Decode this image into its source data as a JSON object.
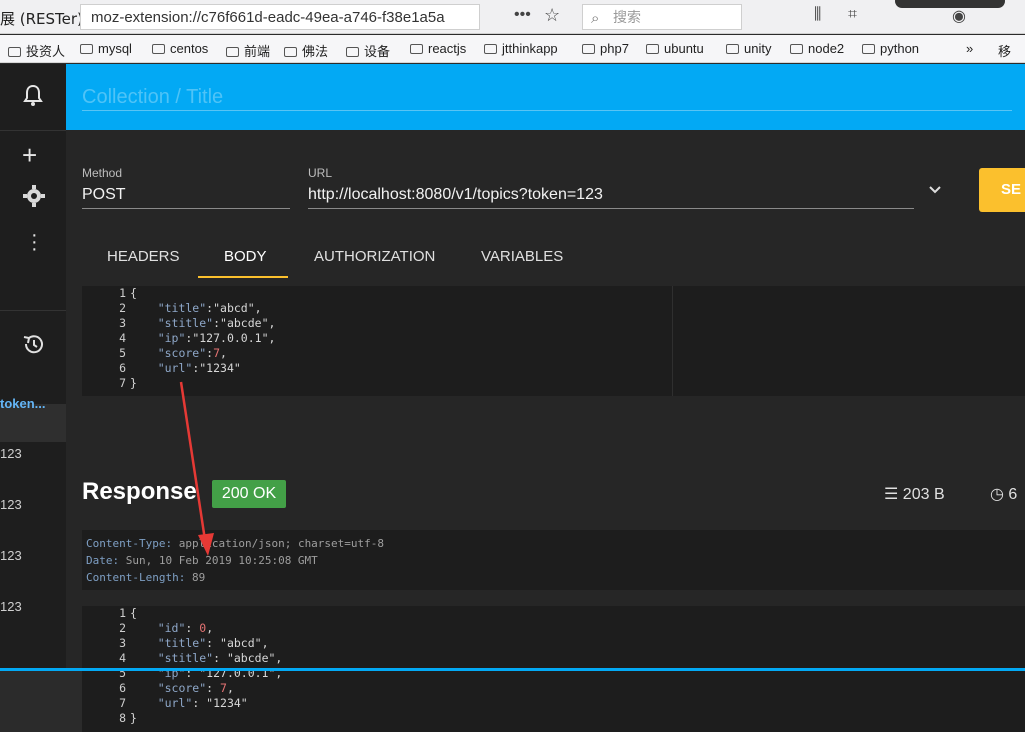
{
  "browser": {
    "tab_title": "展 (RESTer)",
    "url": "moz-extension://c76f661d-eadc-49ea-a746-f38e1a5a",
    "search_placeholder": "搜索",
    "bookmarks": [
      "投资人",
      "mysql",
      "centos",
      "前端",
      "佛法",
      "设备",
      "reactjs",
      "jtthinkapp",
      "php7",
      "ubuntu",
      "unity",
      "node2",
      "python",
      "移"
    ],
    "overflow_label": "»"
  },
  "sidebar": {
    "history_items": [
      "token...",
      "123",
      "123",
      "123",
      "123"
    ]
  },
  "collection": {
    "title_placeholder": "Collection / Title"
  },
  "request": {
    "method_label": "Method",
    "method": "POST",
    "url_label": "URL",
    "url": "http://localhost:8080/v1/topics?token=123",
    "send_label": "SE"
  },
  "tabs": [
    "HEADERS",
    "BODY",
    "AUTHORIZATION",
    "VARIABLES"
  ],
  "active_tab": "BODY",
  "request_body": {
    "line_numbers": [
      "1",
      "2",
      "3",
      "4",
      "5",
      "6",
      "7"
    ],
    "lines": [
      [
        {
          "t": "{",
          "c": "pun"
        }
      ],
      [
        {
          "t": "    \"title\"",
          "c": "key"
        },
        {
          "t": ":",
          "c": "pun"
        },
        {
          "t": "\"abcd\"",
          "c": "str"
        },
        {
          "t": ",",
          "c": "pun"
        }
      ],
      [
        {
          "t": "    \"stitle\"",
          "c": "key"
        },
        {
          "t": ":",
          "c": "pun"
        },
        {
          "t": "\"abcde\"",
          "c": "str"
        },
        {
          "t": ",",
          "c": "pun"
        }
      ],
      [
        {
          "t": "    \"ip\"",
          "c": "key"
        },
        {
          "t": ":",
          "c": "pun"
        },
        {
          "t": "\"127.0.0.1\"",
          "c": "str"
        },
        {
          "t": ",",
          "c": "pun"
        }
      ],
      [
        {
          "t": "    \"score\"",
          "c": "key"
        },
        {
          "t": ":",
          "c": "pun"
        },
        {
          "t": "7",
          "c": "num"
        },
        {
          "t": ",",
          "c": "pun"
        }
      ],
      [
        {
          "t": "    \"url\"",
          "c": "key"
        },
        {
          "t": ":",
          "c": "pun"
        },
        {
          "t": "\"1234\"",
          "c": "str"
        }
      ],
      [
        {
          "t": "}",
          "c": "pun"
        }
      ]
    ]
  },
  "response": {
    "title": "Response",
    "status": "200 OK",
    "size": "203 B",
    "time": "6",
    "headers": [
      {
        "k": "Content-Type",
        "v": "application/json; charset=utf-8"
      },
      {
        "k": "Date",
        "v": "Sun, 10 Feb 2019 10:25:08 GMT"
      },
      {
        "k": "Content-Length",
        "v": "89"
      }
    ],
    "body_line_numbers": [
      "1",
      "2",
      "3",
      "4",
      "5",
      "6",
      "7",
      "8"
    ],
    "body_lines": [
      [
        {
          "t": "{",
          "c": "pun"
        }
      ],
      [
        {
          "t": "    \"id\"",
          "c": "key"
        },
        {
          "t": ": ",
          "c": "pun"
        },
        {
          "t": "0",
          "c": "num"
        },
        {
          "t": ",",
          "c": "pun"
        }
      ],
      [
        {
          "t": "    \"title\"",
          "c": "key"
        },
        {
          "t": ": ",
          "c": "pun"
        },
        {
          "t": "\"abcd\"",
          "c": "str"
        },
        {
          "t": ",",
          "c": "pun"
        }
      ],
      [
        {
          "t": "    \"stitle\"",
          "c": "key"
        },
        {
          "t": ": ",
          "c": "pun"
        },
        {
          "t": "\"abcde\"",
          "c": "str"
        },
        {
          "t": ",",
          "c": "pun"
        }
      ],
      [
        {
          "t": "    \"ip\"",
          "c": "key"
        },
        {
          "t": ": ",
          "c": "pun"
        },
        {
          "t": "\"127.0.0.1\"",
          "c": "str"
        },
        {
          "t": ",",
          "c": "pun"
        }
      ],
      [
        {
          "t": "    \"score\"",
          "c": "key"
        },
        {
          "t": ": ",
          "c": "pun"
        },
        {
          "t": "7",
          "c": "num"
        },
        {
          "t": ",",
          "c": "pun"
        }
      ],
      [
        {
          "t": "    \"url\"",
          "c": "key"
        },
        {
          "t": ": ",
          "c": "pun"
        },
        {
          "t": "\"1234\"",
          "c": "str"
        }
      ],
      [
        {
          "t": "}",
          "c": "pun"
        }
      ]
    ]
  },
  "colors": {
    "accent_blue": "#03a9f4",
    "send_yellow": "#fbc02d",
    "status_green": "#43a047",
    "annotation_red": "#e53935"
  },
  "icons": [
    "bell-icon",
    "plus-icon",
    "gear-icon",
    "more-vert-icon",
    "history-icon",
    "storage-icon",
    "timer-icon",
    "chevron-down-icon",
    "search-icon",
    "star-icon"
  ]
}
